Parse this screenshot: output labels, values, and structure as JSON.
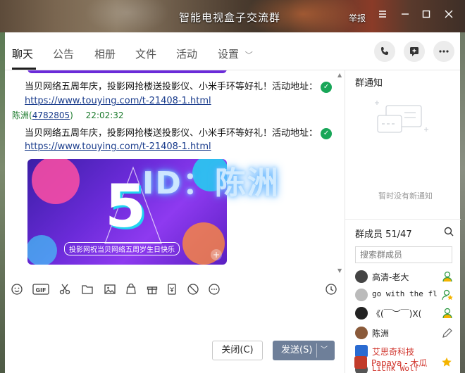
{
  "window": {
    "title": "智能电视盒子交流群",
    "report_label": "举报"
  },
  "tabs": [
    "聊天",
    "公告",
    "相册",
    "文件",
    "活动",
    "设置"
  ],
  "chat": {
    "messages": [
      {
        "text": "当贝网络五周年庆，投影网抢楼送投影仪、小米手环等好礼！活动地址：",
        "link": "https://www.touying.com/t-21408-1.html"
      },
      {
        "sender": "陈洲",
        "sender_id": "4782805",
        "time": "22:02:32",
        "text": "当贝网络五周年庆，投影网抢楼送投影仪、小米手环等好礼！活动地址：",
        "link": "https://www.touying.com/t-21408-1.html",
        "banner_big_text": "5",
        "banner_caption": "投影网祝当贝网络五周岁生日快乐"
      }
    ],
    "watermark": "ID：陈洲"
  },
  "buttons": {
    "close": "关闭(C)",
    "send": "发送(S)"
  },
  "sidebar": {
    "notice_title": "群通知",
    "notice_empty": "暂时没有新通知",
    "members_title": "群成员 51/47",
    "search_placeholder": "搜索群成员",
    "members": [
      {
        "name": "高清-老大",
        "name_color": "#222222",
        "avatar_color": "#444444"
      },
      {
        "name": "go with the fl",
        "name_color": "#222222",
        "avatar_color": "#bbbbbb"
      },
      {
        "name": "《(￣︶￣)X(",
        "name_color": "#222222",
        "avatar_color": "#222222"
      },
      {
        "name": "陈洲",
        "name_color": "#222222",
        "avatar_color": "#8a5a3a"
      },
      {
        "name": "艾思奇科技",
        "name_color": "#d0342c",
        "avatar_color": "#2a6bd1"
      },
      {
        "name": "Lichk Wolf",
        "name_color": "#d0342c",
        "avatar_color": "#555555"
      },
      {
        "name": "Papaya - 木瓜",
        "name_color": "#d0342c",
        "avatar_color": "#c23b2a"
      }
    ]
  },
  "colors": {
    "send_button": "#6e7f99",
    "link": "#1a3c8c",
    "owner_red": "#d0342c",
    "verify_green": "#18a658"
  }
}
